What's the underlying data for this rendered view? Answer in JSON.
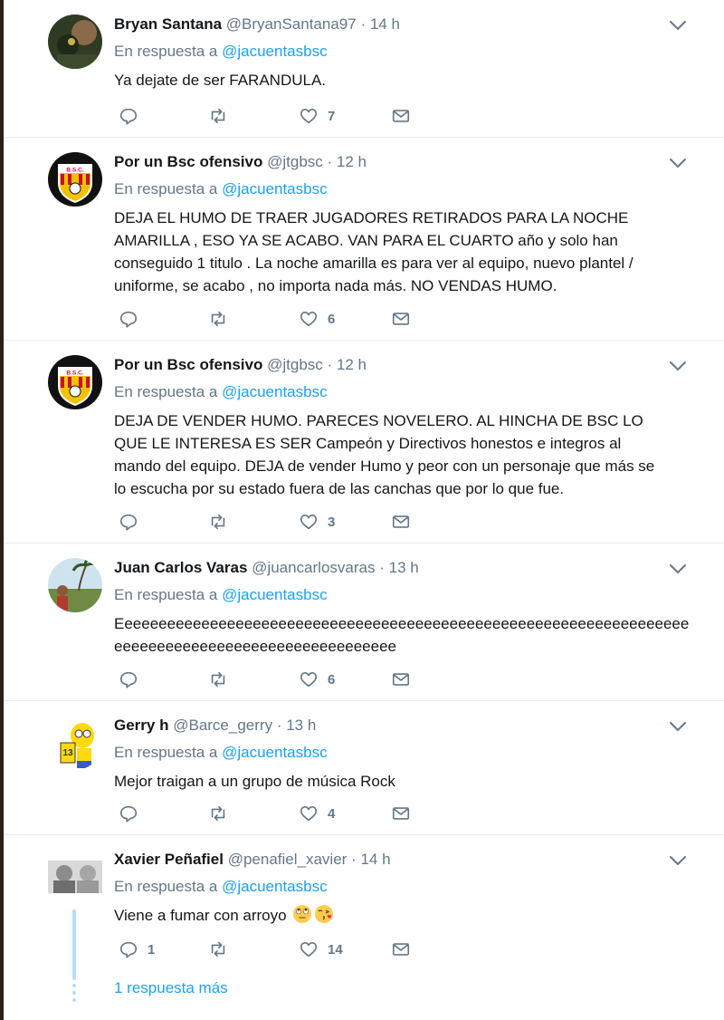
{
  "reply_prefix": "En respuesta a",
  "icons": {
    "reply": "reply-icon",
    "retweet": "retweet-icon",
    "like": "heart-icon",
    "dm": "envelope-icon",
    "menu": "chevron-down-icon"
  },
  "colors": {
    "link": "#1da1f2",
    "secondary": "#657786",
    "text": "#14171a",
    "divider": "#e6ecf0"
  },
  "tweets": [
    {
      "name": "Bryan Santana",
      "handle": "@BryanSantana97",
      "time": "14 h",
      "reply_to": "@jacuentasbsc",
      "lines": [
        "Ya dejate de ser FARANDULA."
      ],
      "likes": "7",
      "replies": ""
    },
    {
      "name": "Por un Bsc ofensivo",
      "handle": "@jtgbsc",
      "time": "12 h",
      "reply_to": "@jacuentasbsc",
      "lines": [
        "DEJA EL HUMO DE TRAER JUGADORES RETIRADOS PARA LA NOCHE",
        "AMARILLA , ESO YA SE ACABO. VAN PARA EL CUARTO año y solo han",
        "conseguido 1 titulo . La noche amarilla es para ver al equipo, nuevo plantel /",
        "uniforme, se acabo , no importa nada más. NO VENDAS HUMO."
      ],
      "likes": "6",
      "replies": ""
    },
    {
      "name": "Por un Bsc ofensivo",
      "handle": "@jtgbsc",
      "time": "12 h",
      "reply_to": "@jacuentasbsc",
      "lines": [
        "DEJA DE VENDER HUMO. PARECES NOVELERO. AL HINCHA DE BSC LO",
        "QUE LE INTERESA ES SER Campeón y Directivos honestos e integros al",
        "mando del equipo. DEJA de vender Humo y peor con un personaje que más se",
        "lo escucha por su estado fuera de las canchas que por lo que fue."
      ],
      "likes": "3",
      "replies": ""
    },
    {
      "name": "Juan Carlos Varas",
      "handle": "@juancarlosvaras",
      "time": "13 h",
      "reply_to": "@jacuentasbsc",
      "lines": [
        "Eeeeeeeeeeeeeeeeeeeeeeeeeeeeeeeeeeeeeeeeeeeeeeeeeeeeeeeeeeeeeeeeeee",
        "eeeeeeeeeeeeeeeeeeeeeeeeeeeeeeeee"
      ],
      "likes": "6",
      "replies": ""
    },
    {
      "name": "Gerry h",
      "handle": "@Barce_gerry",
      "time": "13 h",
      "reply_to": "@jacuentasbsc",
      "lines": [
        "Mejor traigan a un grupo de música Rock"
      ],
      "likes": "4",
      "replies": ""
    },
    {
      "name": "Xavier Peñafiel",
      "handle": "@penafiel_xavier",
      "time": "14 h",
      "reply_to": "@jacuentasbsc",
      "lines": [
        "Viene a fumar con arroyo"
      ],
      "emojis": [
        "face-with-rolling-eyes",
        "face-blowing-a-kiss"
      ],
      "likes": "14",
      "replies": "1"
    }
  ],
  "more_replies": "1 respuesta más"
}
